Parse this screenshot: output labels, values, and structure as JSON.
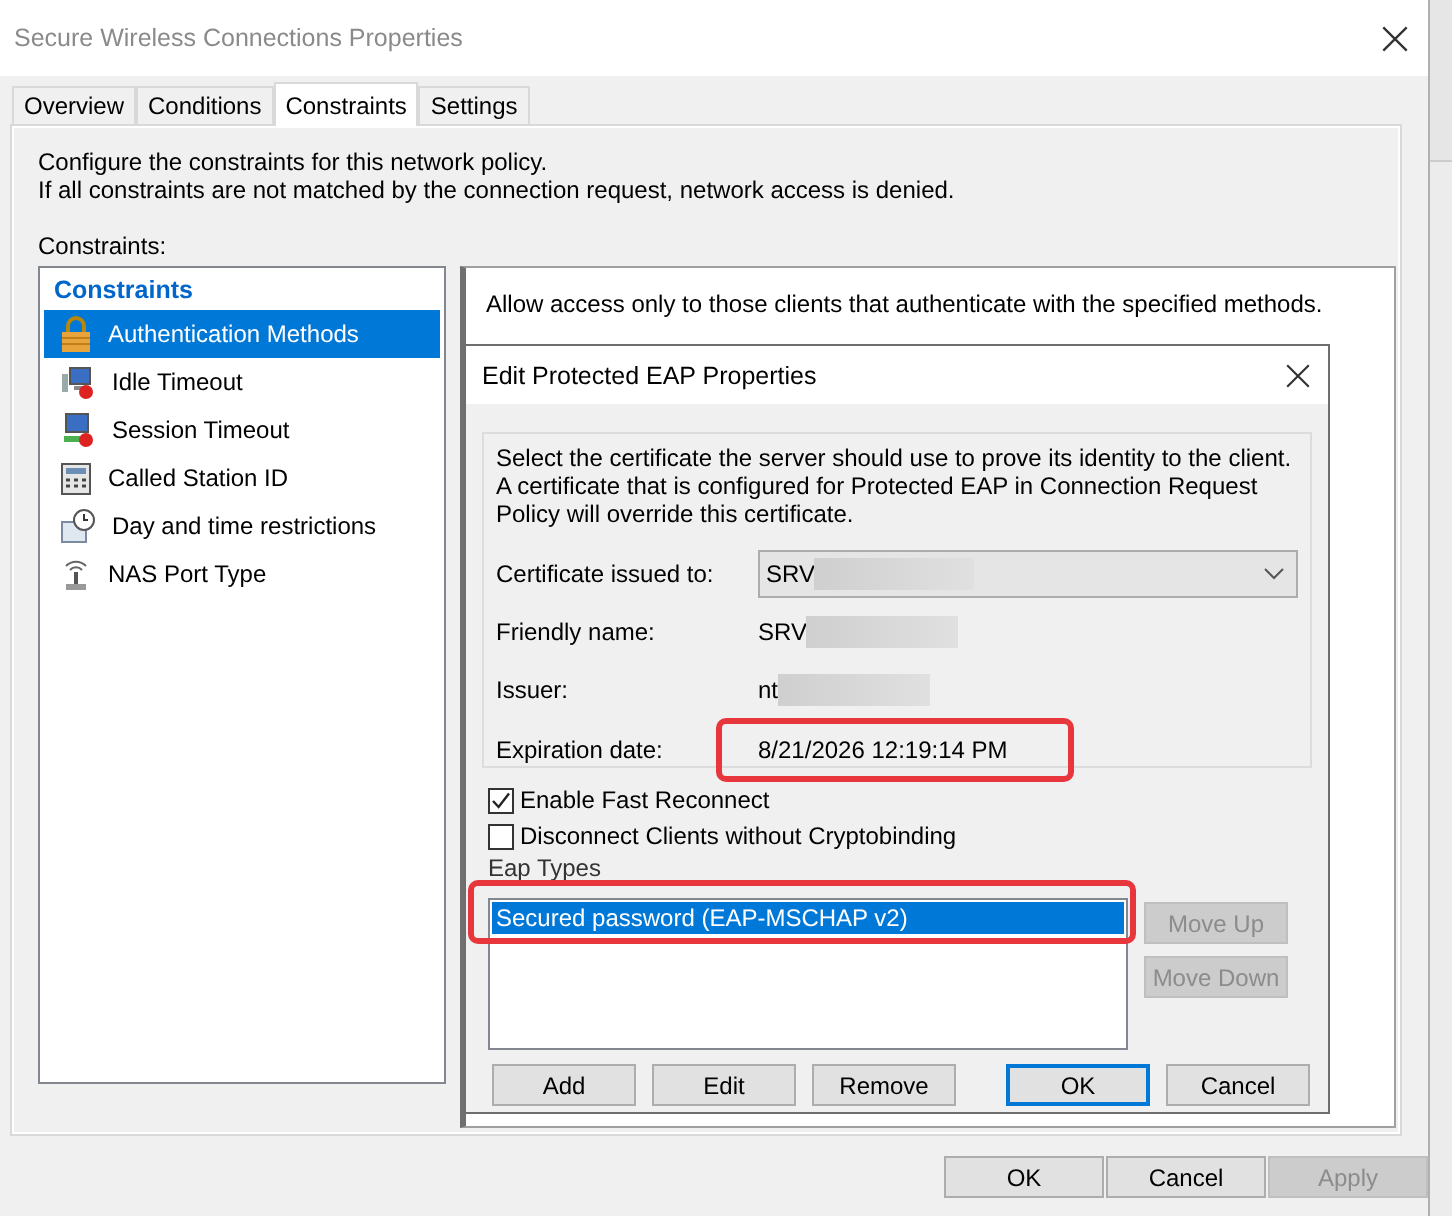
{
  "window": {
    "title": "Secure Wireless Connections Properties"
  },
  "tabs": [
    {
      "label": "Overview",
      "selected": false
    },
    {
      "label": "Conditions",
      "selected": false
    },
    {
      "label": "Constraints",
      "selected": true
    },
    {
      "label": "Settings",
      "selected": false
    }
  ],
  "description": [
    "Configure the constraints for this network policy.",
    "If all constraints are not matched by the connection request, network access is denied."
  ],
  "constraints_label": "Constraints:",
  "constraints_list": {
    "header": "Constraints",
    "items": [
      {
        "label": "Authentication Methods",
        "selected": true
      },
      {
        "label": "Idle Timeout",
        "selected": false
      },
      {
        "label": "Session Timeout",
        "selected": false
      },
      {
        "label": "Called Station ID",
        "selected": false
      },
      {
        "label": "Day and time restrictions",
        "selected": false
      },
      {
        "label": "NAS Port Type",
        "selected": false
      }
    ]
  },
  "detail_text": "Allow access only to those clients that authenticate with the specified methods.",
  "dialog": {
    "title": "Edit Protected EAP Properties",
    "description": [
      "Select the certificate the server should use to prove its identity to the client.",
      "A certificate that is configured for Protected EAP in Connection Request",
      "Policy will override this certificate."
    ],
    "fields": [
      {
        "kind": "dropdown",
        "label": "Certificate issued to:",
        "value": "SRV",
        "redacted": true,
        "highlighted": false
      },
      {
        "kind": "text",
        "label": "Friendly name:",
        "value": "SRV",
        "redacted": true,
        "highlighted": false
      },
      {
        "kind": "text",
        "label": "Issuer:",
        "value": "nt",
        "redacted": true,
        "highlighted": false
      },
      {
        "kind": "text",
        "label": "Expiration date:",
        "value": "8/21/2026 12:19:14 PM",
        "redacted": false,
        "highlighted": true
      }
    ],
    "checkboxes": [
      {
        "label": "Enable Fast Reconnect",
        "checked": true
      },
      {
        "label": "Disconnect Clients without Cryptobinding",
        "checked": false
      }
    ],
    "eap_types_label": "Eap Types",
    "eap_types": [
      {
        "label": "Secured password (EAP-MSCHAP v2)",
        "selected": true,
        "highlighted": true
      }
    ],
    "side_buttons": [
      {
        "label": "Move Up",
        "disabled": true
      },
      {
        "label": "Move Down",
        "disabled": true
      }
    ],
    "buttons": [
      {
        "label": "Add",
        "default": false
      },
      {
        "label": "Edit",
        "default": false
      },
      {
        "label": "Remove",
        "default": false
      },
      {
        "label": "OK",
        "default": true
      },
      {
        "label": "Cancel",
        "default": false
      }
    ]
  },
  "buttons": [
    {
      "label": "OK",
      "disabled": false
    },
    {
      "label": "Cancel",
      "disabled": false
    },
    {
      "label": "Apply",
      "disabled": true
    }
  ]
}
